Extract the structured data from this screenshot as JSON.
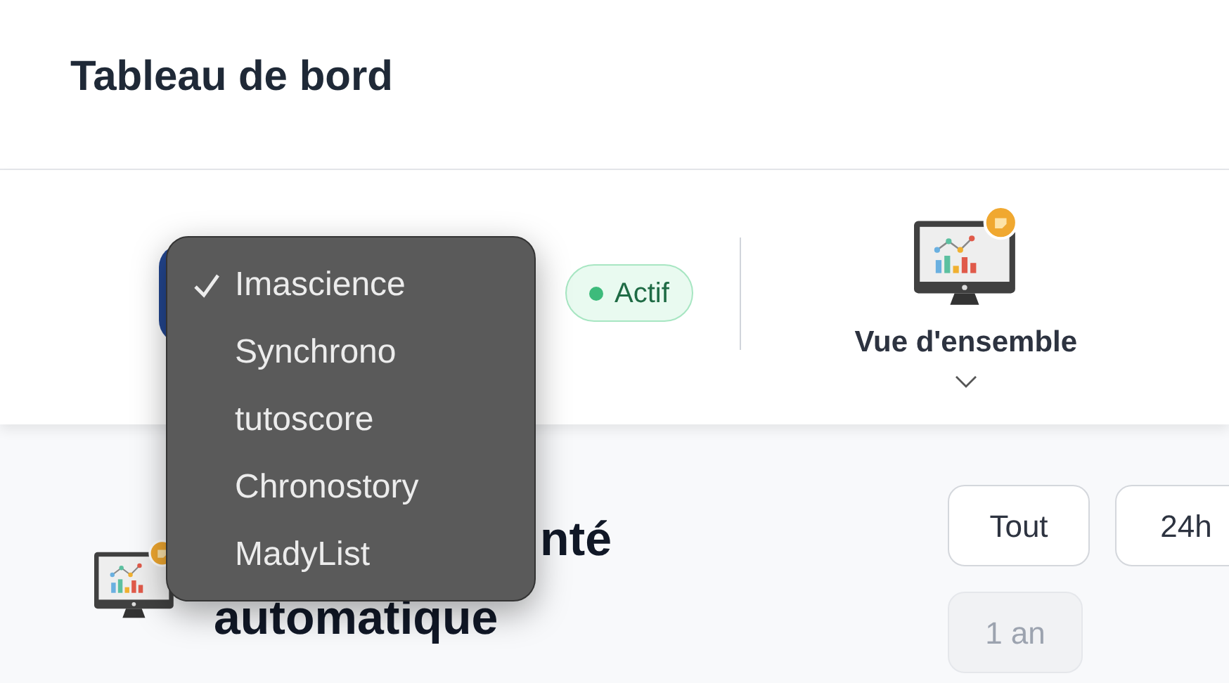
{
  "header": {
    "title": "Tableau de bord"
  },
  "toolbar": {
    "status_badge": "Actif",
    "view_selector": {
      "label": "Vue d'ensemble"
    }
  },
  "dropdown_menu": {
    "items": [
      {
        "label": "Imascience",
        "selected": true
      },
      {
        "label": "Synchrono",
        "selected": false
      },
      {
        "label": "tutoscore",
        "selected": false
      },
      {
        "label": "Chronostory",
        "selected": false
      },
      {
        "label": "MadyList",
        "selected": false
      }
    ]
  },
  "section": {
    "title_lines": [
      "nté",
      "automatique"
    ],
    "filters": [
      {
        "label": "Tout",
        "disabled": false
      },
      {
        "label": "24h",
        "disabled": false
      },
      {
        "label": "1 an",
        "disabled": true
      }
    ]
  }
}
